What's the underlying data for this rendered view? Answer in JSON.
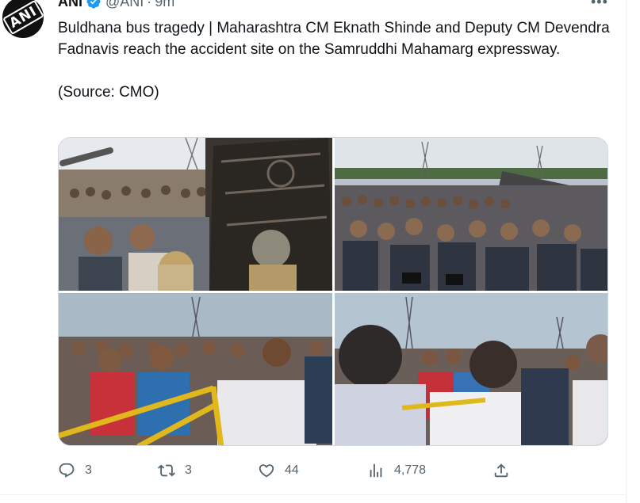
{
  "author": {
    "name": "ANI",
    "handle": "@ANI",
    "separator": "·",
    "time": "9m",
    "avatar_text": "ANI"
  },
  "tweet": {
    "text": "Buldhana bus tragedy | Maharashtra CM Eknath Shinde and Deputy CM Devendra Fadnavis reach the accident site on the Samruddhi Mahamarg expressway.\n\n(Source: CMO)"
  },
  "actions": {
    "replies": "3",
    "retweets": "3",
    "likes": "44",
    "views": "4,778"
  },
  "icons": {
    "verified": "verified-badge-icon",
    "more": "more-icon",
    "reply": "reply-icon",
    "retweet": "retweet-icon",
    "like": "heart-icon",
    "views": "views-icon",
    "share": "share-icon"
  },
  "colors": {
    "verified": "#1d9bf0",
    "text_primary": "#0f1419",
    "text_secondary": "#536471",
    "border": "#cfd9de"
  }
}
